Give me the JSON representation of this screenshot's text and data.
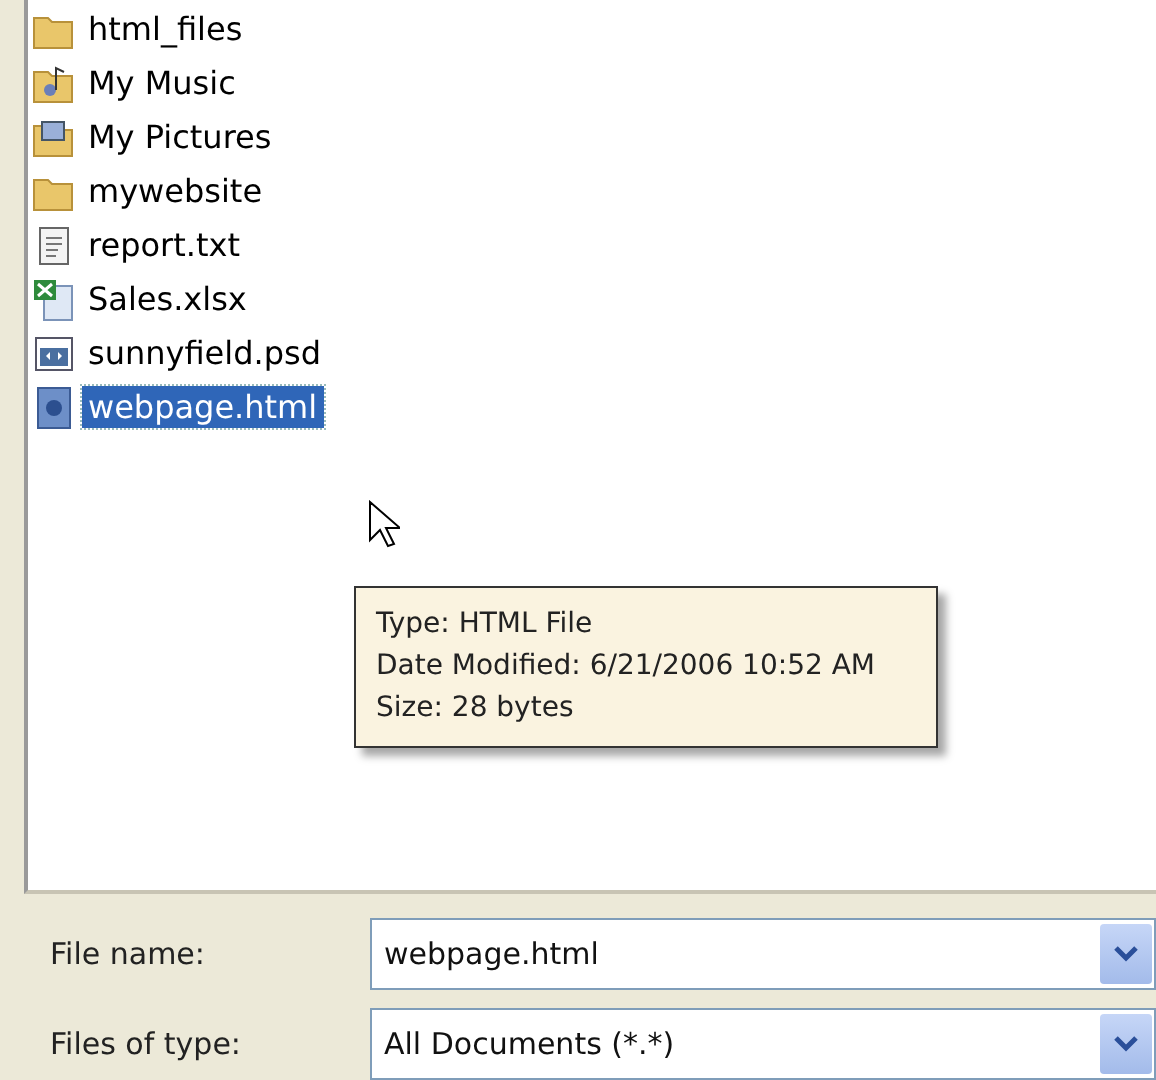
{
  "files": [
    {
      "name": "html_files",
      "kind": "folder",
      "selected": false
    },
    {
      "name": "My Music",
      "kind": "music-folder",
      "selected": false
    },
    {
      "name": "My Pictures",
      "kind": "pictures-folder",
      "selected": false
    },
    {
      "name": "mywebsite",
      "kind": "folder",
      "selected": false
    },
    {
      "name": "report.txt",
      "kind": "text",
      "selected": false
    },
    {
      "name": "Sales.xlsx",
      "kind": "spreadsheet",
      "selected": false
    },
    {
      "name": "sunnyfield.psd",
      "kind": "image",
      "selected": false
    },
    {
      "name": "webpage.html",
      "kind": "html",
      "selected": true
    }
  ],
  "tooltip": [
    "Type: HTML File",
    "Date Modified: 6/21/2006 10:52 AM",
    "Size: 28 bytes"
  ],
  "fields": [
    {
      "label": "File name:",
      "value": "webpage.html"
    },
    {
      "label": "Files of type:",
      "value": "All Documents (*.*)"
    }
  ]
}
